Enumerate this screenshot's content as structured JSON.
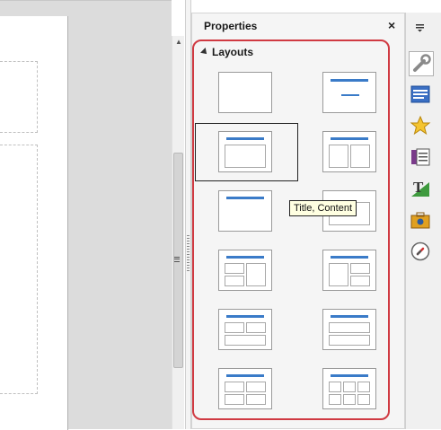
{
  "panel": {
    "title": "Properties",
    "close_label": "×"
  },
  "layouts": {
    "heading": "Layouts",
    "tooltip": "Title, Content",
    "items": [
      "Blank Slide",
      "Title Slide",
      "Title, Content",
      "Title and 2 Content",
      "Title Only",
      "Centered Text",
      "Title, 2 Content and Content",
      "Title, Content and 2 Content",
      "Title, 2 Content over Content",
      "Title, Content over Content",
      "Title, 4 Content",
      "Title, 6 Content"
    ]
  },
  "tabbar": {
    "menu_icon": "hamburger-icon",
    "tabs": [
      "properties-wrench-icon",
      "slide-transition-icon",
      "custom-animation-icon",
      "master-slides-icon",
      "styles-icon",
      "gallery-icon",
      "navigator-icon"
    ]
  }
}
